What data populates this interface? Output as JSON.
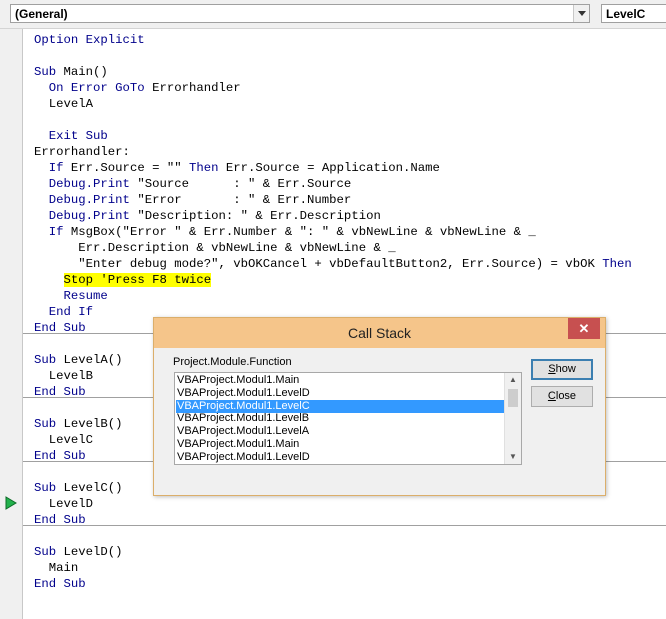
{
  "toolbar": {
    "object_combo": "(General)",
    "procedure_combo": "LevelC"
  },
  "code_lines": [
    {
      "segments": [
        {
          "t": "Option Explicit",
          "k": 1
        }
      ]
    },
    {
      "segments": []
    },
    {
      "segments": [
        {
          "t": "Sub ",
          "k": 1
        },
        {
          "t": "Main()",
          "k": 0
        }
      ]
    },
    {
      "segments": [
        {
          "t": "  On Error GoTo ",
          "k": 1
        },
        {
          "t": "Errorhandler",
          "k": 0
        }
      ]
    },
    {
      "segments": [
        {
          "t": "  LevelA",
          "k": 0
        }
      ]
    },
    {
      "segments": []
    },
    {
      "segments": [
        {
          "t": "  Exit Sub",
          "k": 1
        }
      ]
    },
    {
      "segments": [
        {
          "t": "Errorhandler:",
          "k": 0
        }
      ]
    },
    {
      "segments": [
        {
          "t": "  If ",
          "k": 1
        },
        {
          "t": "Err.Source = \"\" ",
          "k": 0
        },
        {
          "t": "Then ",
          "k": 1
        },
        {
          "t": "Err.Source = Application.Name",
          "k": 0
        }
      ]
    },
    {
      "segments": [
        {
          "t": "  Debug.Print ",
          "k": 1
        },
        {
          "t": "\"Source      : \" & Err.Source",
          "k": 0
        }
      ]
    },
    {
      "segments": [
        {
          "t": "  Debug.Print ",
          "k": 1
        },
        {
          "t": "\"Error       : \" & Err.Number",
          "k": 0
        }
      ]
    },
    {
      "segments": [
        {
          "t": "  Debug.Print ",
          "k": 1
        },
        {
          "t": "\"Description: \" & Err.Description",
          "k": 0
        }
      ]
    },
    {
      "segments": [
        {
          "t": "  If ",
          "k": 1
        },
        {
          "t": "MsgBox(\"Error \" & Err.Number & \": \" & vbNewLine & vbNewLine & _",
          "k": 0
        }
      ]
    },
    {
      "segments": [
        {
          "t": "      Err.Description & vbNewLine & vbNewLine & _",
          "k": 0
        }
      ]
    },
    {
      "segments": [
        {
          "t": "      \"Enter debug mode?\", vbOKCancel + vbDefaultButton2, Err.Source) = vbOK ",
          "k": 0
        },
        {
          "t": "Then",
          "k": 1
        }
      ]
    },
    {
      "segments": [
        {
          "t": "    ",
          "k": 0
        },
        {
          "t": "Stop 'Press F8 twice",
          "k": 2
        }
      ]
    },
    {
      "segments": [
        {
          "t": "    Resume",
          "k": 1
        }
      ]
    },
    {
      "segments": [
        {
          "t": "  End If",
          "k": 1
        }
      ]
    },
    {
      "segments": [
        {
          "t": "End Sub",
          "k": 1
        }
      ]
    },
    {
      "segments": []
    },
    {
      "segments": [
        {
          "t": "Sub ",
          "k": 1
        },
        {
          "t": "LevelA()",
          "k": 0
        }
      ]
    },
    {
      "segments": [
        {
          "t": "  LevelB",
          "k": 0
        }
      ]
    },
    {
      "segments": [
        {
          "t": "End Sub",
          "k": 1
        }
      ]
    },
    {
      "segments": []
    },
    {
      "segments": [
        {
          "t": "Sub ",
          "k": 1
        },
        {
          "t": "LevelB()",
          "k": 0
        }
      ]
    },
    {
      "segments": [
        {
          "t": "  LevelC",
          "k": 0
        }
      ]
    },
    {
      "segments": [
        {
          "t": "End Sub",
          "k": 1
        }
      ]
    },
    {
      "segments": []
    },
    {
      "segments": [
        {
          "t": "Sub ",
          "k": 1
        },
        {
          "t": "LevelC()",
          "k": 0
        }
      ]
    },
    {
      "segments": [
        {
          "t": "  LevelD",
          "k": 0
        }
      ]
    },
    {
      "segments": [
        {
          "t": "End Sub",
          "k": 1
        }
      ]
    },
    {
      "segments": []
    },
    {
      "segments": [
        {
          "t": "Sub ",
          "k": 1
        },
        {
          "t": "LevelD()",
          "k": 0
        }
      ]
    },
    {
      "segments": [
        {
          "t": "  Main",
          "k": 0
        }
      ]
    },
    {
      "segments": [
        {
          "t": "End Sub",
          "k": 1
        }
      ]
    }
  ],
  "colors": {
    "keyword": "#00008b",
    "highlight": "#ffff00",
    "exec_arrow": "#f0e000",
    "callstack_marker": "#22b14c",
    "dialog_title_bg": "#f5c58a",
    "selection": "#3399ff"
  },
  "icons": {
    "exec_arrow": "execution-point-arrow-icon",
    "callstack_marker": "call-stack-triangle-icon"
  },
  "dialog": {
    "title": "Call Stack",
    "close_glyph": "✕",
    "list_header": "Project.Module.Function",
    "items": [
      "VBAProject.Modul1.Main",
      "VBAProject.Modul1.LevelD",
      "VBAProject.Modul1.LevelC",
      "VBAProject.Modul1.LevelB",
      "VBAProject.Modul1.LevelA",
      "VBAProject.Modul1.Main",
      "VBAProject.Modul1.LevelD"
    ],
    "selected_index": 2,
    "show_label": "Show",
    "close_label": "Close"
  }
}
